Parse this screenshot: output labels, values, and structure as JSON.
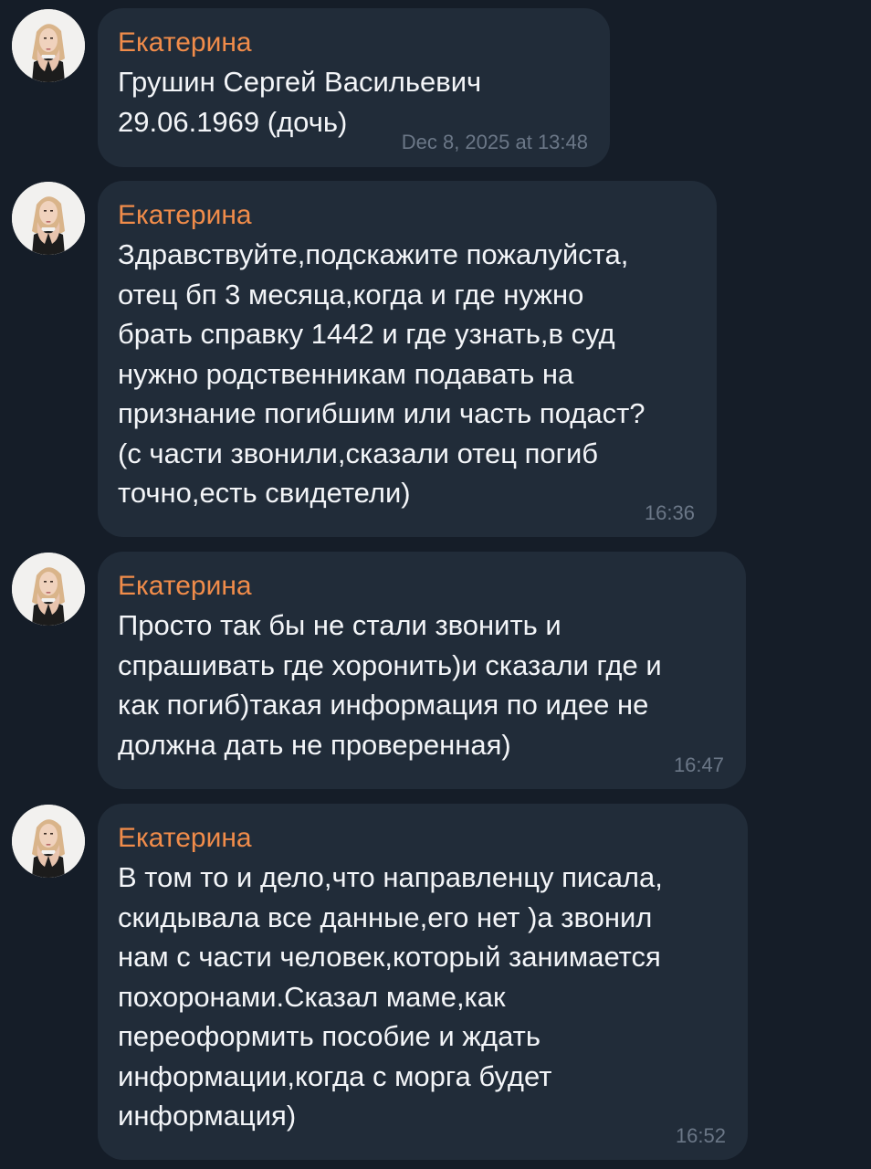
{
  "theme": {
    "background": "#151d28",
    "bubble": "#212c39",
    "sender_color": "#f18c4a",
    "text_color": "#f3f5f8",
    "time_color": "#6b7787"
  },
  "messages": [
    {
      "sender": "Екатерина",
      "lines": [
        "Грушин Сергей Васильевич",
        "29.06.1969 (дочь)"
      ],
      "time": "Dec 8, 2025 at 13:48"
    },
    {
      "sender": "Екатерина",
      "lines": [
        "Здравствуйте,подскажите пожалуйста,",
        "отец бп 3 месяца,когда и где  нужно",
        "брать справку 1442 и где узнать,в суд",
        "нужно родственникам подавать на",
        "признание погибшим или часть подаст?",
        "(с части звонили,сказали отец погиб",
        "точно,есть свидетели)"
      ],
      "time": "16:36"
    },
    {
      "sender": "Екатерина",
      "lines": [
        "Просто так бы не стали звонить и",
        "спрашивать где хоронить)и сказали где и",
        "как погиб)такая информация по идее не",
        "должна дать не проверенная)"
      ],
      "time": "16:47"
    },
    {
      "sender": "Екатерина",
      "lines": [
        "В том то и дело,что направленцу  писала,",
        "скидывала все данные,его нет )а звонил",
        "нам с части человек,который занимается",
        "похоронами.Сказал маме,как",
        "переоформить пособие и ждать",
        "информации,когда с морга будет",
        "информация)"
      ],
      "time": "16:52"
    }
  ]
}
